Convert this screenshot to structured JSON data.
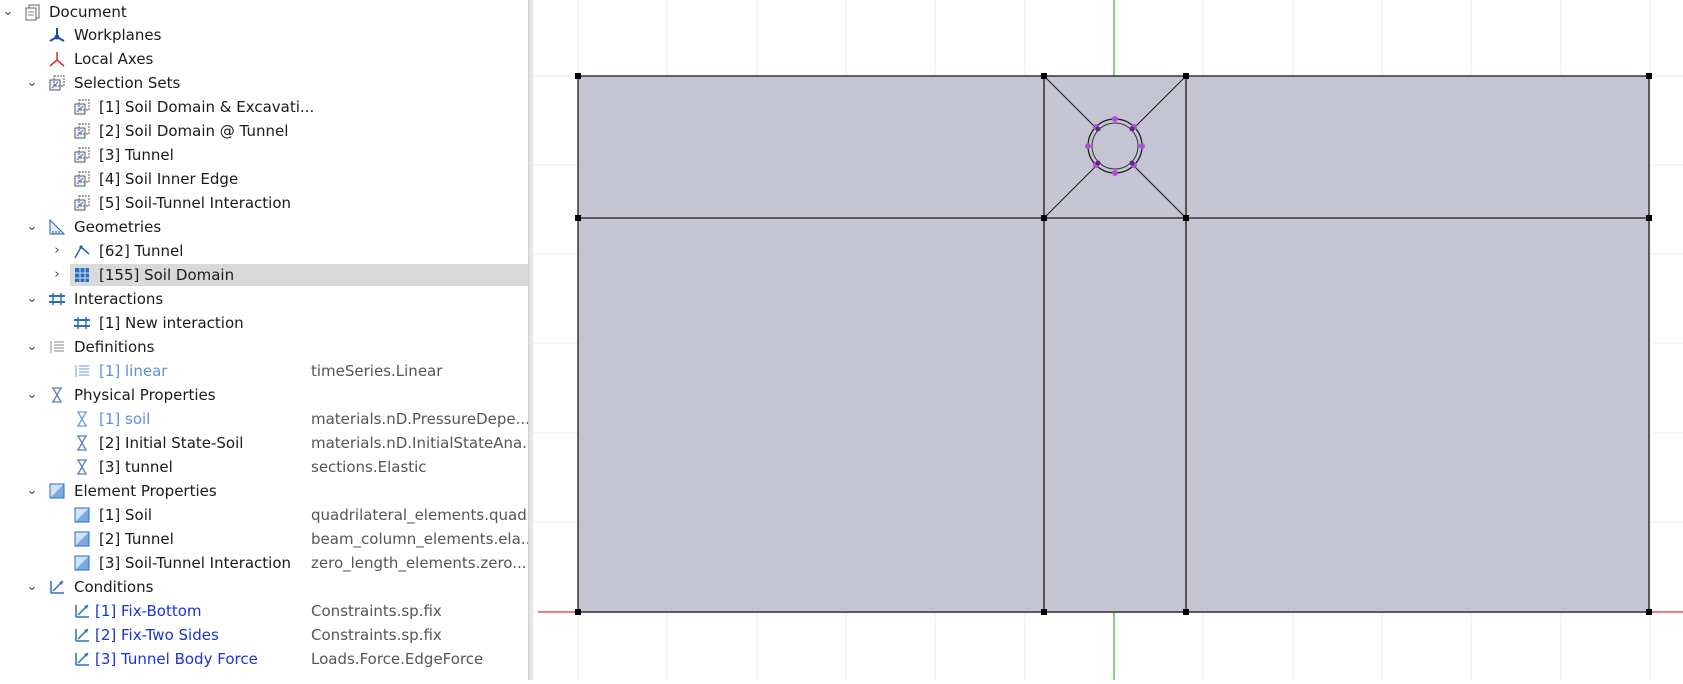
{
  "tree": {
    "root": "Document",
    "workplanes": "Workplanes",
    "local_axes": "Local Axes",
    "selection_sets": {
      "label": "Selection Sets",
      "items": [
        "[1] Soil Domain & Excavati...",
        "[2] Soil Domain @ Tunnel",
        "[3] Tunnel",
        "[4] Soil Inner Edge",
        "[5] Soil-Tunnel Interaction"
      ]
    },
    "geometries": {
      "label": "Geometries",
      "items": [
        "[62] Tunnel",
        "[155] Soil Domain"
      ]
    },
    "interactions": {
      "label": "Interactions",
      "items": [
        "[1] New interaction"
      ]
    },
    "definitions": {
      "label": "Definitions",
      "items": [
        {
          "label": "[1] linear",
          "value": "timeSeries.Linear"
        }
      ]
    },
    "physical_properties": {
      "label": "Physical Properties",
      "items": [
        {
          "label": "[1] soil",
          "value": "materials.nD.PressureDepe..."
        },
        {
          "label": "[2] Initial State-Soil",
          "value": "materials.nD.InitialStateAna..."
        },
        {
          "label": "[3] tunnel",
          "value": "sections.Elastic"
        }
      ]
    },
    "element_properties": {
      "label": "Element Properties",
      "items": [
        {
          "label": "[1] Soil",
          "value": "quadrilateral_elements.quad"
        },
        {
          "label": "[2] Tunnel",
          "value": "beam_column_elements.ela..."
        },
        {
          "label": "[3] Soil-Tunnel Interaction",
          "value": "zero_length_elements.zero..."
        }
      ]
    },
    "conditions": {
      "label": "Conditions",
      "items": [
        {
          "label": "[1] Fix-Bottom",
          "value": "Constraints.sp.fix"
        },
        {
          "label": "[2] Fix-Two Sides",
          "value": "Constraints.sp.fix"
        },
        {
          "label": "[3] Tunnel Body Force",
          "value": "Loads.Force.EdgeForce"
        }
      ]
    }
  },
  "colors": {
    "selection": "#d9d9d9",
    "link_text": "#5b8fe0",
    "condition_text": "#1a33d6",
    "domain_fill": "#c4c4d2",
    "tunnel_nodes": "#b04fd6",
    "axis_x": "#e03a3a",
    "axis_y": "#2fb52f"
  }
}
